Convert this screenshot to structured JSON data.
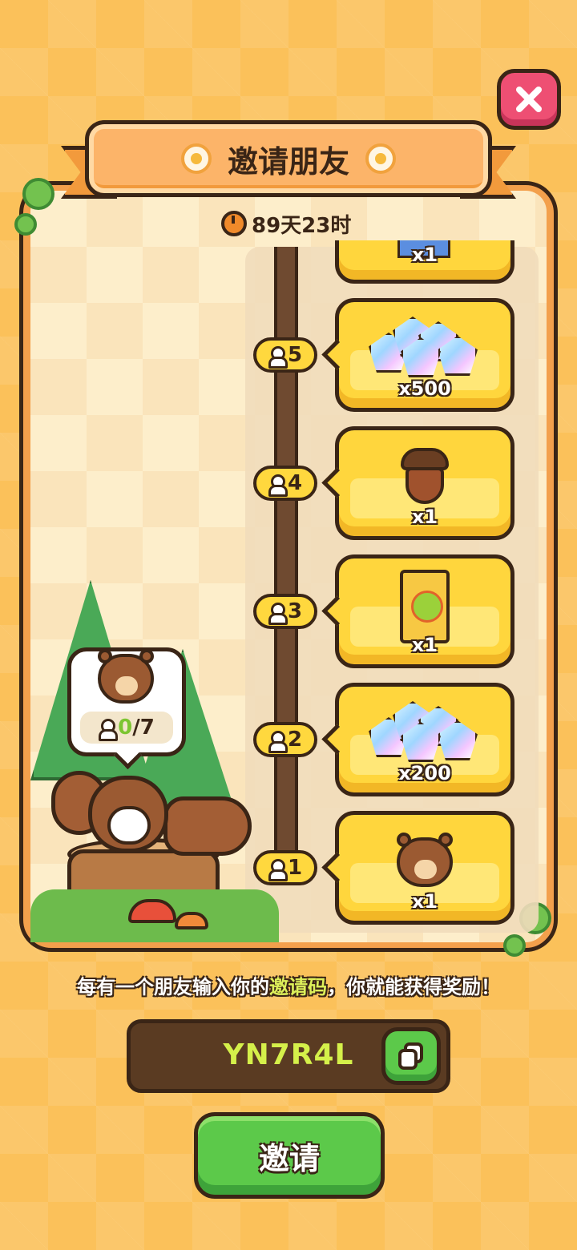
{
  "header": {
    "title": "邀请朋友",
    "timer": "89天23时"
  },
  "rewards": [
    {
      "tier": "1",
      "item": "squirrel",
      "qty": "x1"
    },
    {
      "tier": "2",
      "item": "gems",
      "qty": "x200"
    },
    {
      "tier": "3",
      "item": "seed-pack",
      "qty": "x1"
    },
    {
      "tier": "4",
      "item": "acorn",
      "qty": "x1"
    },
    {
      "tier": "5",
      "item": "gems",
      "qty": "x500"
    }
  ],
  "partial_top_reward": {
    "qty": "x1"
  },
  "progress": {
    "current": "0",
    "total": "/7"
  },
  "info": {
    "prefix": "每有一个朋友输入你的",
    "highlight": "邀请码",
    "suffix": "，你就能获得奖励！"
  },
  "invite_code": "YN7R4L",
  "invite_button": "邀请",
  "colors": {
    "background": "#fbc15a",
    "panel": "#f3a04c",
    "card": "#ffd63d",
    "green": "#5cc94a",
    "outline": "#3a2516",
    "close": "#ee4f73"
  }
}
